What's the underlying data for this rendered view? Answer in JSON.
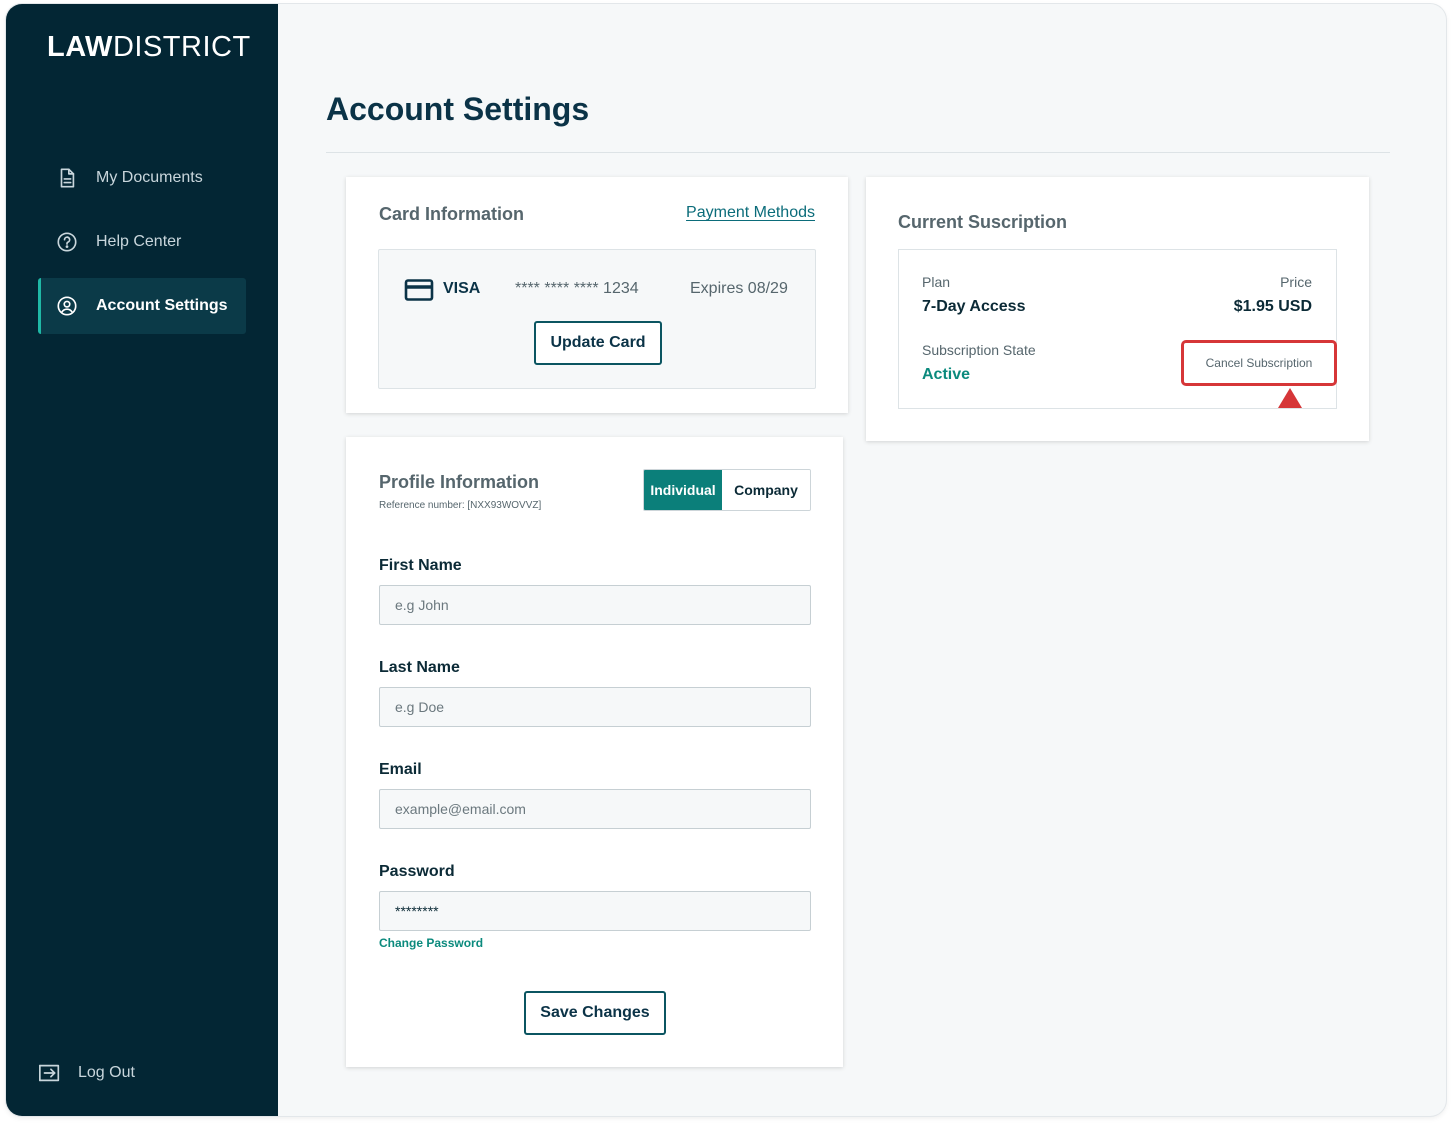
{
  "brand": {
    "bold": "LAW",
    "regular": "DISTRICT"
  },
  "sidebar": {
    "items": [
      {
        "label": "My Documents",
        "icon": "document-icon"
      },
      {
        "label": "Help Center",
        "icon": "help-circle-icon"
      },
      {
        "label": "Account Settings",
        "icon": "user-circle-icon",
        "active": true
      }
    ],
    "logout": "Log Out"
  },
  "page": {
    "title": "Account Settings"
  },
  "card_info": {
    "title": "Card Information",
    "link": "Payment Methods",
    "brand": "VISA",
    "number": "**** **** **** 1234",
    "expires": "Expires 08/29",
    "update_button": "Update Card"
  },
  "subscription": {
    "title": "Current Suscription",
    "plan_label": "Plan",
    "plan_value": "7-Day Access",
    "price_label": "Price",
    "price_value": "$1.95 USD",
    "state_label": "Subscription State",
    "state_value": "Active",
    "cancel_button": "Cancel Subscription"
  },
  "profile": {
    "title": "Profile Information",
    "reference": "Reference number: [NXX93WOVVZ]",
    "toggle": {
      "individual": "Individual",
      "company": "Company",
      "selected": "Individual"
    },
    "first_name": {
      "label": "First Name",
      "placeholder": "e.g John"
    },
    "last_name": {
      "label": "Last Name",
      "placeholder": "e.g Doe"
    },
    "email": {
      "label": "Email",
      "placeholder": "example@email.com"
    },
    "password": {
      "label": "Password",
      "value": "********"
    },
    "change_password": "Change Password",
    "save_button": "Save Changes"
  },
  "colors": {
    "sidebar_bg": "#032634",
    "accent": "#0b7f7a",
    "highlight": "#d63638"
  }
}
